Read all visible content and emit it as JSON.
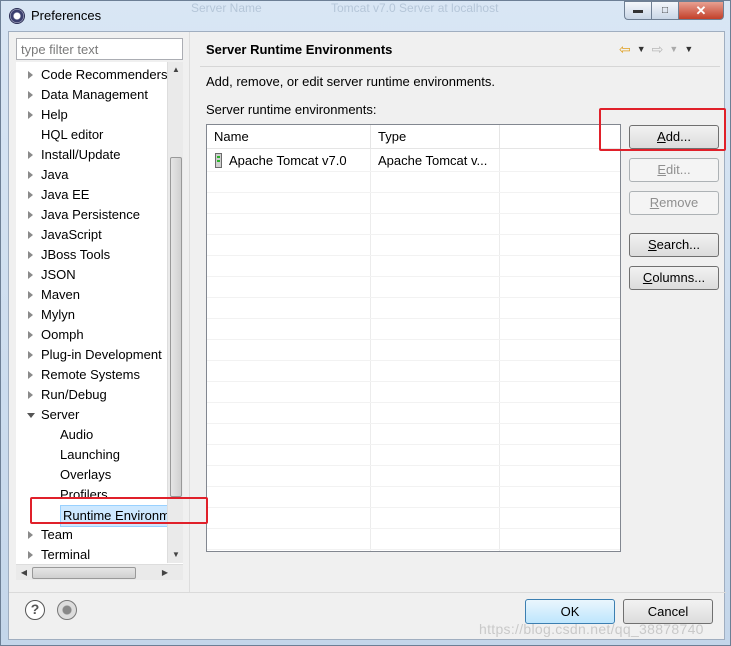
{
  "window": {
    "title": "Preferences",
    "ghost_text_1": "Server Name",
    "ghost_text_2": "Tomcat v7.0 Server at localhost"
  },
  "sidebar": {
    "filter_placeholder": "type filter text",
    "items": [
      {
        "label": "Code Recommenders",
        "arrow": "right",
        "level": 0
      },
      {
        "label": "Data Management",
        "arrow": "right",
        "level": 0
      },
      {
        "label": "Help",
        "arrow": "right",
        "level": 0
      },
      {
        "label": "HQL editor",
        "arrow": "none",
        "level": 0
      },
      {
        "label": "Install/Update",
        "arrow": "right",
        "level": 0
      },
      {
        "label": "Java",
        "arrow": "right",
        "level": 0
      },
      {
        "label": "Java EE",
        "arrow": "right",
        "level": 0
      },
      {
        "label": "Java Persistence",
        "arrow": "right",
        "level": 0
      },
      {
        "label": "JavaScript",
        "arrow": "right",
        "level": 0
      },
      {
        "label": "JBoss Tools",
        "arrow": "right",
        "level": 0
      },
      {
        "label": "JSON",
        "arrow": "right",
        "level": 0
      },
      {
        "label": "Maven",
        "arrow": "right",
        "level": 0
      },
      {
        "label": "Mylyn",
        "arrow": "right",
        "level": 0
      },
      {
        "label": "Oomph",
        "arrow": "right",
        "level": 0
      },
      {
        "label": "Plug-in Development",
        "arrow": "right",
        "level": 0
      },
      {
        "label": "Remote Systems",
        "arrow": "right",
        "level": 0
      },
      {
        "label": "Run/Debug",
        "arrow": "right",
        "level": 0
      },
      {
        "label": "Server",
        "arrow": "down",
        "level": 0
      },
      {
        "label": "Audio",
        "arrow": "none",
        "level": 1
      },
      {
        "label": "Launching",
        "arrow": "none",
        "level": 1
      },
      {
        "label": "Overlays",
        "arrow": "none",
        "level": 1
      },
      {
        "label": "Profilers",
        "arrow": "none",
        "level": 1
      },
      {
        "label": "Runtime Environm",
        "arrow": "none",
        "level": 1,
        "selected": true
      },
      {
        "label": "Team",
        "arrow": "right",
        "level": 0
      },
      {
        "label": "Terminal",
        "arrow": "right",
        "level": 0
      }
    ]
  },
  "page": {
    "title": "Server Runtime Environments",
    "description": "Add, remove, or edit server runtime environments.",
    "list_label": "Server runtime environments:"
  },
  "table": {
    "columns": [
      "Name",
      "Type"
    ],
    "rows": [
      {
        "name": "Apache Tomcat v7.0",
        "type": "Apache Tomcat v..."
      }
    ]
  },
  "buttons": {
    "add": "Add...",
    "edit": "Edit...",
    "remove": "Remove",
    "search": "Search...",
    "columns": "Columns..."
  },
  "footer": {
    "ok": "OK",
    "cancel": "Cancel"
  },
  "watermark": "https://blog.csdn.net/qq_38878740",
  "colors": {
    "highlight": "#e0202a",
    "selection": "#cde8ff"
  }
}
